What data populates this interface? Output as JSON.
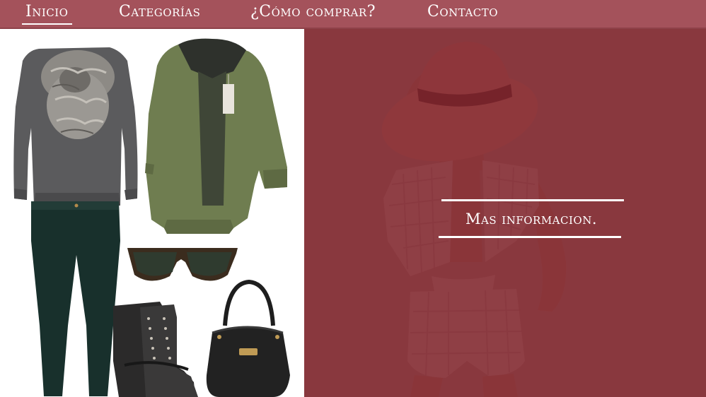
{
  "nav": {
    "items": [
      {
        "label": "Inicio",
        "active": true
      },
      {
        "label": "Categorías",
        "active": false
      },
      {
        "label": "¿Cómo comprar?",
        "active": false
      },
      {
        "label": "Contacto",
        "active": false
      }
    ]
  },
  "hero": {
    "cta_label": "Mas informacion."
  },
  "colors": {
    "nav_background": "#a4525b",
    "hero_overlay": "#80242c",
    "text": "#ffffff"
  }
}
